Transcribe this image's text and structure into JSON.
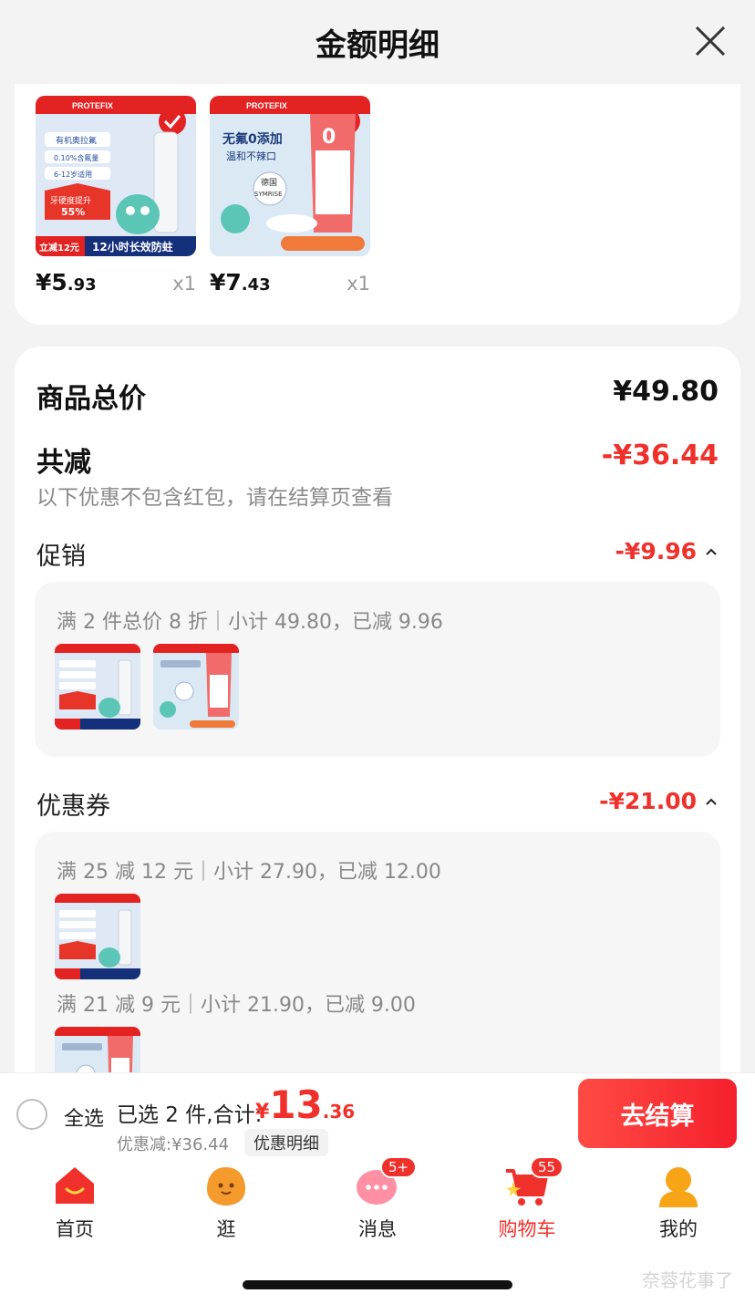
{
  "header": {
    "title": "金额明细"
  },
  "products": [
    {
      "price_int": "¥5",
      "price_dec": ".93",
      "qty": "x1",
      "thumb_texts": [
        "有机奥拉氟",
        "0.10%含氟量",
        "6-12岁适用",
        "牙硬度提升",
        "55%",
        "立减12元",
        "12小时长效防蛀",
        "PROTEFIX"
      ]
    },
    {
      "price_int": "¥7",
      "price_dec": ".43",
      "qty": "x1",
      "thumb_texts": [
        "无氟0添加",
        "温和不辣口",
        "德国",
        "SYMRISE",
        "PROTEFIX"
      ]
    }
  ],
  "summary": {
    "total_label": "商品总价",
    "total_value": "¥49.80",
    "reduce_label": "共减",
    "reduce_value": "-¥36.44",
    "note": "以下优惠不包含红包，请在结算页查看"
  },
  "promotion": {
    "label": "促销",
    "value": "-¥9.96",
    "line": "满 2 件总价 8 折｜小计 49.80，已减 9.96"
  },
  "coupon": {
    "label": "优惠券",
    "value": "-¥21.00",
    "line1": "满 25 减 12 元｜小计 27.90，已减 12.00",
    "line2": "满 21 减 9 元｜小计 21.90，已减 9.00"
  },
  "bottom": {
    "select_all": "全选",
    "selected": "已选 2 件,合计:",
    "currency": "¥",
    "total_int": "13",
    "total_dec": ".36",
    "discount": "优惠减:¥36.44",
    "detail_chip": "优惠明细",
    "checkout": "去结算"
  },
  "tabs": [
    {
      "label": "首页",
      "icon": "home-icon"
    },
    {
      "label": "逛",
      "icon": "stroll-icon"
    },
    {
      "label": "消息",
      "icon": "message-icon",
      "badge": "5+"
    },
    {
      "label": "购物车",
      "icon": "cart-icon",
      "badge": "55",
      "active": true
    },
    {
      "label": "我的",
      "icon": "profile-icon"
    }
  ],
  "watermark": "奈蓉花事了",
  "colors": {
    "accent": "#f0302a",
    "background": "#f3f3f3"
  }
}
